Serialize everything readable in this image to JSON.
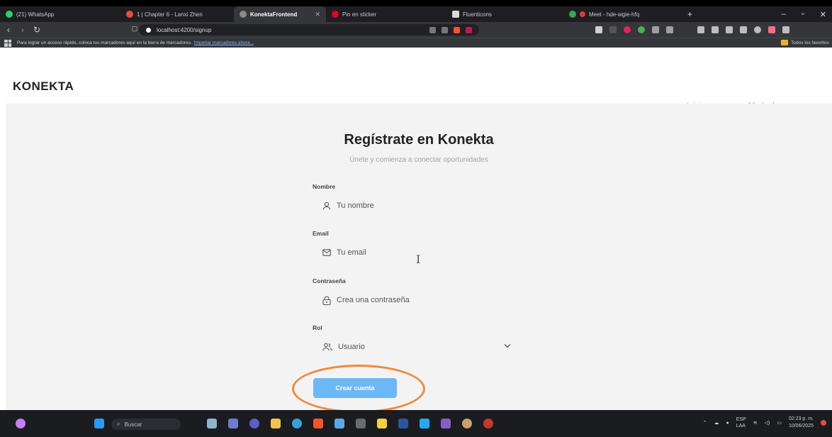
{
  "browser": {
    "tabs": [
      {
        "label": "(21) WhatsApp",
        "color": "#25d366"
      },
      {
        "label": "1 | Chapter 6 - Lanxi Zhen",
        "color": "#e74c3c"
      },
      {
        "label": "KonektaFrontend",
        "color": "#8a8a8a"
      },
      {
        "label": "Pin en sticker",
        "color": "#e60023"
      },
      {
        "label": "Fluenticons",
        "color": "#d9d9d9"
      },
      {
        "label": "Meet - hde-wgie-hfq",
        "color": "#34a853"
      }
    ],
    "active_tab": 2,
    "url": "localhost:4200/signup",
    "bookmarks_prompt": "Para lograr un acceso rápido, coloca tus marcadores aquí en la barra de marcadores.",
    "bookmarks_link": "Importar marcadores ahora...",
    "all_bookmarks": "Todos los favoritos"
  },
  "app": {
    "logo": "KONEKTA",
    "nav": [
      "Inicio",
      "Modo de uso"
    ]
  },
  "form": {
    "title": "Regístrate en Konekta",
    "subtitle": "Únete y comienza a conectar oportunidades",
    "name_label": "Nombre",
    "name_placeholder": "Tu nombre",
    "email_label": "Email",
    "email_placeholder": "Tu email",
    "password_label": "Contraseña",
    "password_placeholder": "Crea una contraseña",
    "role_label": "Rol",
    "role_value": "Usuario",
    "submit": "Crear cuenta"
  },
  "annotation_color": "#ef8a3a",
  "taskbar": {
    "search": "Buscar",
    "lang_1": "ESP",
    "lang_2": "LAA",
    "time": "02:23 p. m.",
    "date": "10/06/2025"
  }
}
